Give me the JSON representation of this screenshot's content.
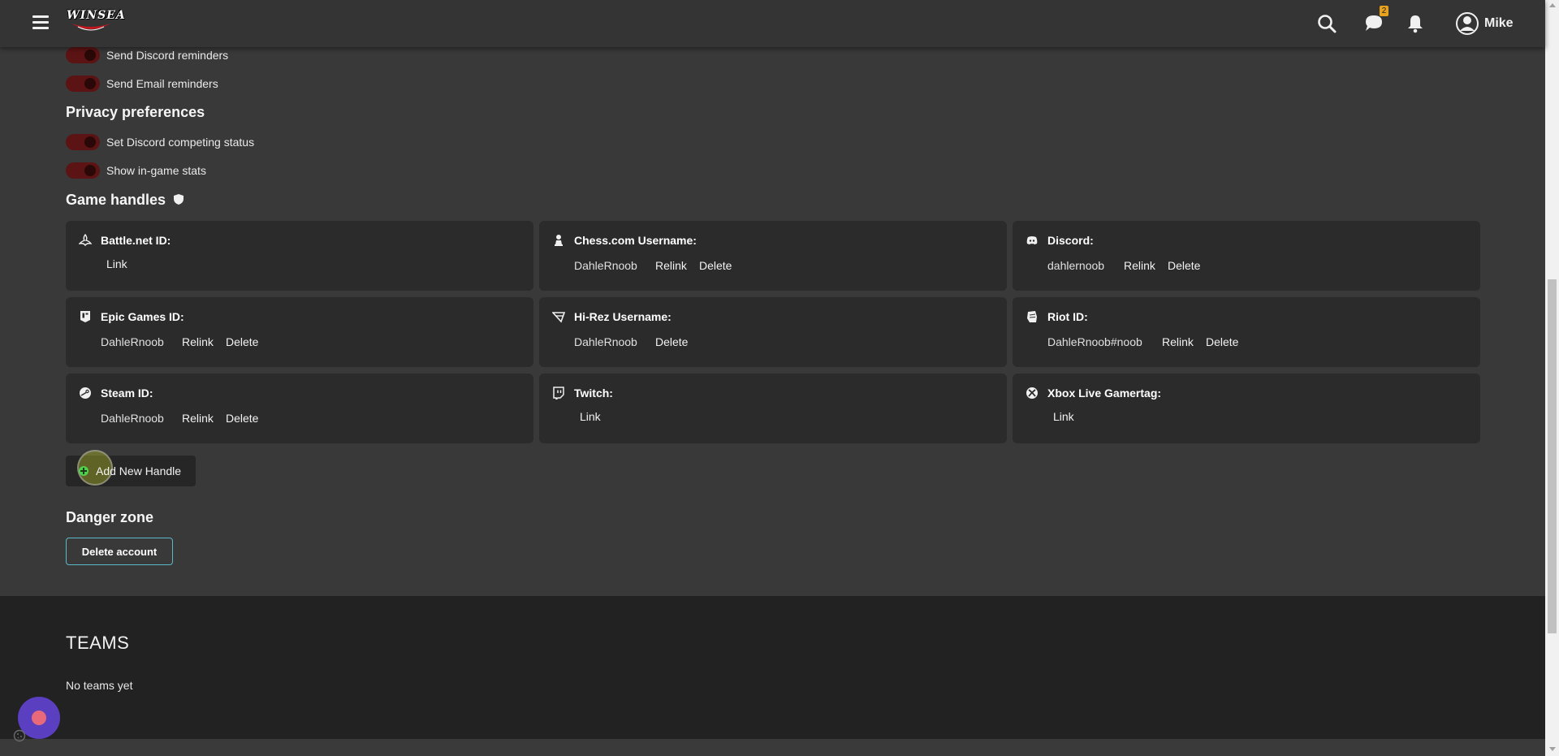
{
  "header": {
    "logo_text": "WINSEA",
    "messages_badge": "2",
    "user_name": "Mike"
  },
  "notifications": {
    "items": [
      {
        "label": "Send Discord reminders"
      },
      {
        "label": "Send Email reminders"
      }
    ]
  },
  "privacy": {
    "title": "Privacy preferences",
    "items": [
      {
        "label": "Set Discord competing status"
      },
      {
        "label": "Show in-game stats"
      }
    ]
  },
  "game_handles": {
    "title": "Game handles",
    "cards": [
      {
        "title": "Battle.net ID:",
        "icon": "battlenet-icon",
        "link": "Link"
      },
      {
        "title": "Chess.com Username:",
        "icon": "chess-pawn-icon",
        "value": "DahleRnoob",
        "relink": "Relink",
        "delete": "Delete"
      },
      {
        "title": "Discord:",
        "icon": "discord-icon",
        "value": "dahlernoob",
        "relink": "Relink",
        "delete": "Delete"
      },
      {
        "title": "Epic Games ID:",
        "icon": "epic-games-icon",
        "value": "DahleRnoob",
        "relink": "Relink",
        "delete": "Delete"
      },
      {
        "title": "Hi-Rez Username:",
        "icon": "hirez-icon",
        "value": "DahleRnoob",
        "delete": "Delete"
      },
      {
        "title": "Riot ID:",
        "icon": "riot-fist-icon",
        "value": "DahleRnoob#noob",
        "relink": "Relink",
        "delete": "Delete"
      },
      {
        "title": "Steam ID:",
        "icon": "steam-icon",
        "value": "DahleRnoob",
        "relink": "Relink",
        "delete": "Delete"
      },
      {
        "title": "Twitch:",
        "icon": "twitch-icon",
        "link": "Link"
      },
      {
        "title": "Xbox Live Gamertag:",
        "icon": "xbox-icon",
        "link": "Link"
      }
    ],
    "add_button": "Add New Handle"
  },
  "danger_zone": {
    "title": "Danger zone",
    "delete_button": "Delete account"
  },
  "teams": {
    "title": "TEAMS",
    "empty_text": "No teams yet"
  },
  "colors": {
    "background": "#3a3939",
    "card": "#2b2b2b",
    "toggle_off": "#5c1313",
    "accent_teal": "#5bb8c8",
    "badge": "#e8a21b",
    "chat_bubble": "#5a3fc0"
  }
}
